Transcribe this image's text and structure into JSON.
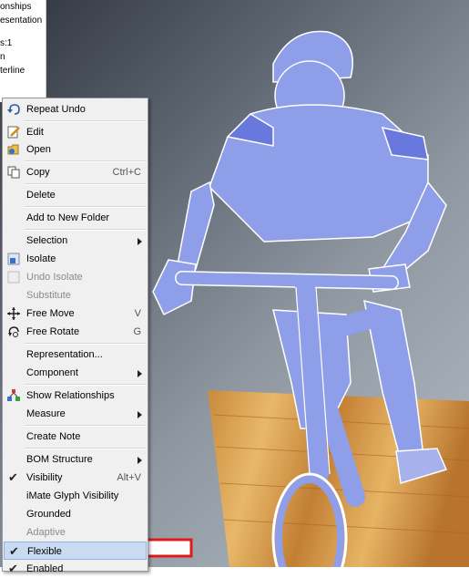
{
  "browser": {
    "lines": [
      "onships",
      "esentation",
      "s:1",
      "n",
      "terline"
    ]
  },
  "menu": {
    "repeat_undo": "Repeat Undo",
    "edit": "Edit",
    "open": "Open",
    "copy": "Copy",
    "copy_shortcut": "Ctrl+C",
    "delete": "Delete",
    "add_to_new_folder": "Add to New Folder",
    "selection": "Selection",
    "isolate": "Isolate",
    "undo_isolate": "Undo Isolate",
    "substitute": "Substitute",
    "free_move": "Free Move",
    "free_move_shortcut": "V",
    "free_rotate": "Free Rotate",
    "free_rotate_shortcut": "G",
    "representation": "Representation...",
    "component": "Component",
    "show_relationships": "Show Relationships",
    "measure": "Measure",
    "create_note": "Create Note",
    "bom_structure": "BOM Structure",
    "visibility": "Visibility",
    "visibility_shortcut": "Alt+V",
    "imate_glyph_visibility": "iMate Glyph Visibility",
    "grounded": "Grounded",
    "adaptive": "Adaptive",
    "flexible": "Flexible",
    "enabled": "Enabled"
  },
  "colors": {
    "model": "#8f9ee8",
    "highlight_arrow": "#e01b1b",
    "menu_bg": "#f0f0f0"
  }
}
